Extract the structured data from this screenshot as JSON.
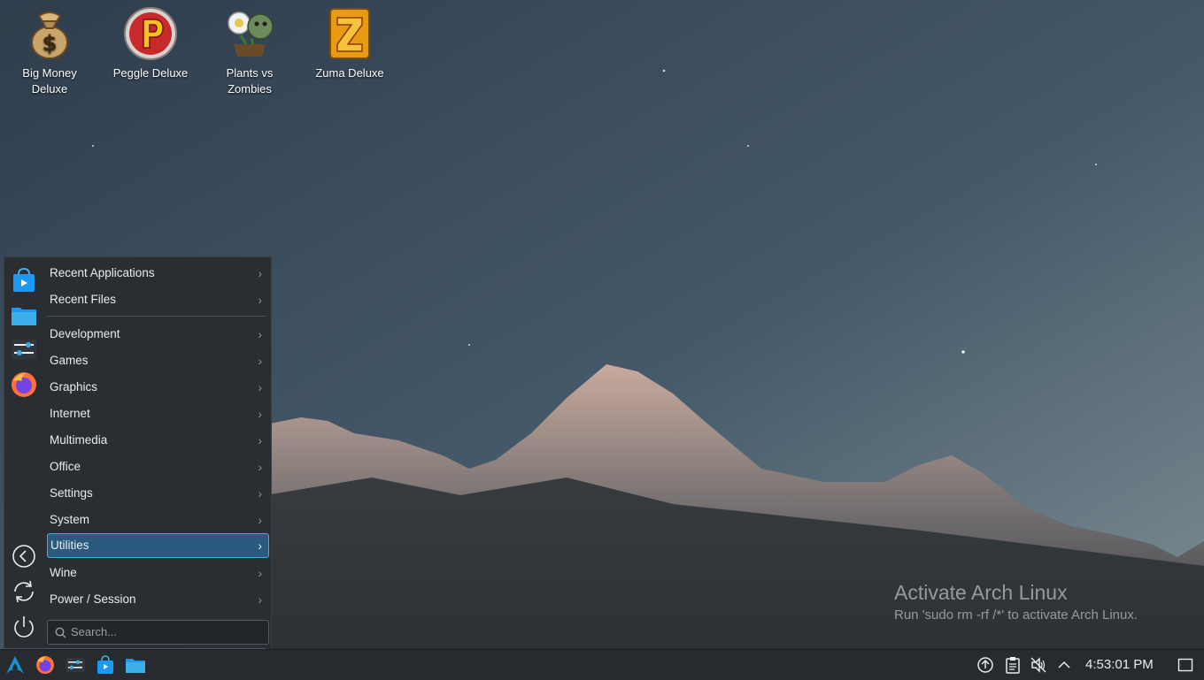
{
  "desktop": {
    "icons": [
      {
        "label": "Big Money Deluxe",
        "icon": "money-bag-icon"
      },
      {
        "label": "Peggle Deluxe",
        "icon": "peggle-icon"
      },
      {
        "label": "Plants vs Zombies",
        "icon": "plants-vs-zombies-icon"
      },
      {
        "label": "Zuma Deluxe",
        "icon": "zuma-icon"
      }
    ]
  },
  "watermark": {
    "title": "Activate Arch Linux",
    "subtitle": "Run 'sudo rm -rf /*' to activate Arch Linux."
  },
  "app_menu": {
    "favorites": [
      {
        "icon": "store-icon"
      },
      {
        "icon": "folder-icon"
      },
      {
        "icon": "settings-icon"
      },
      {
        "icon": "firefox-icon"
      }
    ],
    "session_buttons": [
      {
        "icon": "logout-icon"
      },
      {
        "icon": "restart-icon"
      },
      {
        "icon": "shutdown-icon"
      }
    ],
    "items": [
      {
        "label": "Recent Applications"
      },
      {
        "label": "Recent Files"
      },
      {
        "label": "Development"
      },
      {
        "label": "Games"
      },
      {
        "label": "Graphics"
      },
      {
        "label": "Internet"
      },
      {
        "label": "Multimedia"
      },
      {
        "label": "Office"
      },
      {
        "label": "Settings"
      },
      {
        "label": "System"
      },
      {
        "label": "Utilities",
        "selected": true
      },
      {
        "label": "Wine"
      },
      {
        "label": "Power / Session"
      }
    ],
    "search_placeholder": "Search..."
  },
  "taskbar": {
    "launchers": [
      {
        "icon": "arch-launcher-icon"
      },
      {
        "icon": "firefox-icon"
      },
      {
        "icon": "settings-icon"
      },
      {
        "icon": "store-icon"
      },
      {
        "icon": "folder-icon"
      }
    ],
    "tray": [
      {
        "icon": "updates-icon"
      },
      {
        "icon": "clipboard-icon"
      },
      {
        "icon": "volume-muted-icon"
      },
      {
        "icon": "tray-expand-icon"
      }
    ],
    "clock": "4:53:01 PM"
  },
  "colors": {
    "accent": "#3daee9",
    "panel": "#2a2e32",
    "selection": "#2a5b7e"
  }
}
